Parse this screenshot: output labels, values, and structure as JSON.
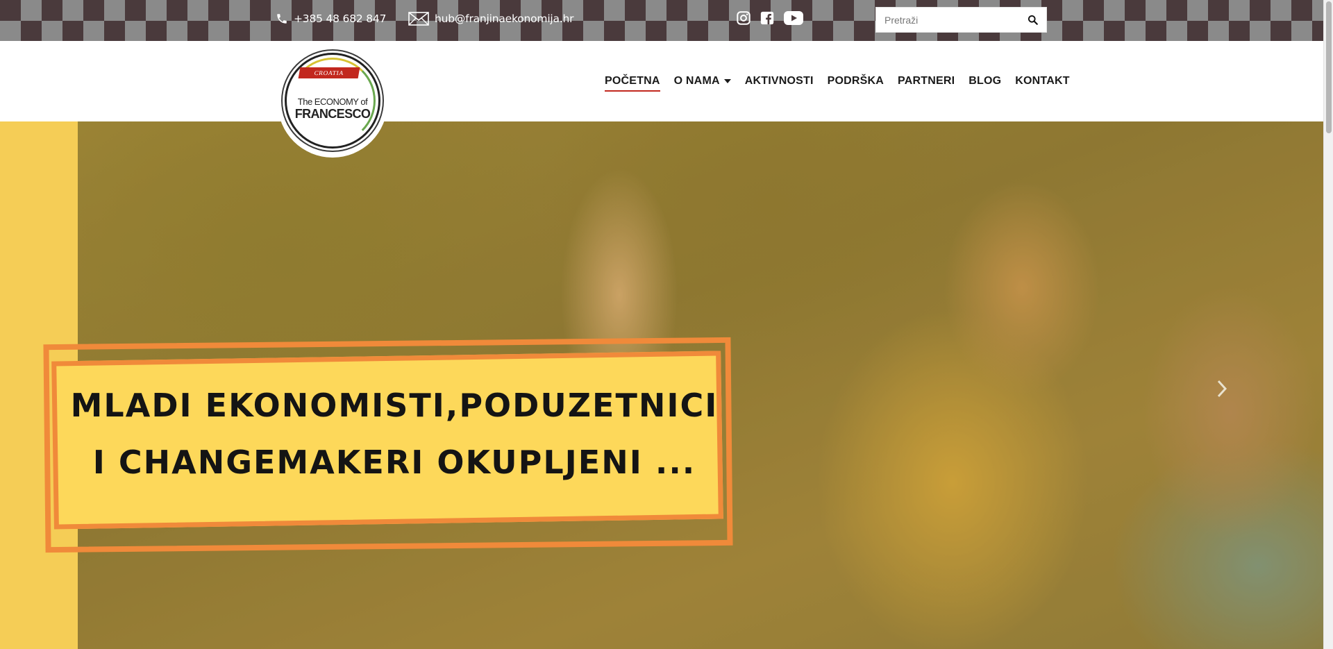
{
  "topbar": {
    "phone": "+385 48 682 847",
    "email": "hub@franjinaekonomija.hr",
    "social": [
      "instagram-icon",
      "facebook-icon",
      "youtube-icon"
    ],
    "search_placeholder": "Pretraži"
  },
  "logo": {
    "banner": "CROATIA",
    "line1": "The ECONOMY of",
    "line2": "FRANCESCO"
  },
  "nav": {
    "items": [
      "POČETNA",
      "O NAMA",
      "AKTIVNOSTI",
      "PODRŠKA",
      "PARTNERI",
      "BLOG",
      "KONTAKT"
    ],
    "active": "POČETNA"
  },
  "hero": {
    "caption": "MLADI EKONOMISTI,PODUZETNICI\nI CHANGEMAKERI OKUPLJENI ..."
  },
  "colors": {
    "accent_red": "#c2281e",
    "caption_fill": "#fdd85a",
    "caption_frame": "#f08a3a",
    "hero_side": "#f5cd56"
  }
}
